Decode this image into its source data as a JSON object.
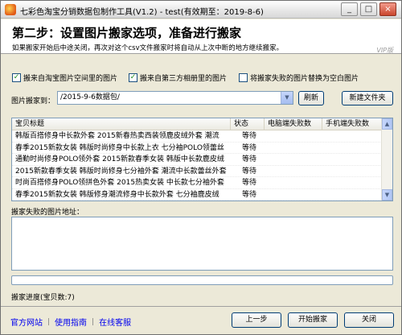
{
  "window": {
    "title": "七彩色淘宝分销数据包制作工具(V1.2) - test(有效期至：2019-8-6)",
    "controls": {
      "minimize": "_",
      "maximize": "□",
      "close": "×"
    }
  },
  "header": {
    "title": "第二步：设置图片搬家选项，准备进行搬家",
    "subtitle": "如果搬家开始后中途关闭，再次对这个csv文件搬家时将自动从上次中断的地方继续搬家。",
    "badge": "VIP版"
  },
  "options": [
    {
      "label": "搬来自淘宝图片空间里的图片",
      "checked": true
    },
    {
      "label": "搬来自第三方相册里的图片",
      "checked": true
    },
    {
      "label": "将搬家失败的图片替换为空白图片",
      "checked": false
    }
  ],
  "path": {
    "label": "图片搬家到：",
    "value": "/2015-9-6数据包/",
    "refresh_label": "刷新",
    "new_folder_label": "新建文件夹"
  },
  "table": {
    "columns": [
      "宝贝标题",
      "状态",
      "电脑端失败数",
      "手机端失败数"
    ],
    "rows": [
      {
        "title": "韩版百搭修身中长款外套 2015新春热卖西装领鹿皮绒外套 潮流",
        "status": "等待",
        "pc": "",
        "mobile": ""
      },
      {
        "title": "春季2015新款女装 韩版时尚修身中长款上衣 七分袖POLO领蕾丝",
        "status": "等待",
        "pc": "",
        "mobile": ""
      },
      {
        "title": "通勤时尚修身POLO领外套 2015新款春季女装 韩版中长款鹿皮绒",
        "status": "等待",
        "pc": "",
        "mobile": ""
      },
      {
        "title": "2015新款春季女装 韩版时尚修身七分袖外套 潮流中长款蕾丝外套",
        "status": "等待",
        "pc": "",
        "mobile": ""
      },
      {
        "title": "时尚百搭修身POLO领拼色外套 2015热卖女装 中长款七分袖外套",
        "status": "等待",
        "pc": "",
        "mobile": ""
      },
      {
        "title": "春季2015新款女装 韩版修身潮流修身中长款外套 七分袖鹿皮绒",
        "status": "等待",
        "pc": "",
        "mobile": ""
      }
    ]
  },
  "failed": {
    "label": "搬家失败的图片地址：",
    "value": ""
  },
  "progress": {
    "value": 0,
    "label": "搬家进度(宝贝数:7)"
  },
  "footer": {
    "links": [
      "官方网站",
      "使用指南",
      "在线客服"
    ],
    "separator": "|",
    "prev_label": "上一步",
    "start_label": "开始搬家",
    "close_label": "关闭"
  },
  "colors": {
    "link": "#0000ee",
    "progress": "#3d95ff",
    "check": "#1a8a1a"
  }
}
